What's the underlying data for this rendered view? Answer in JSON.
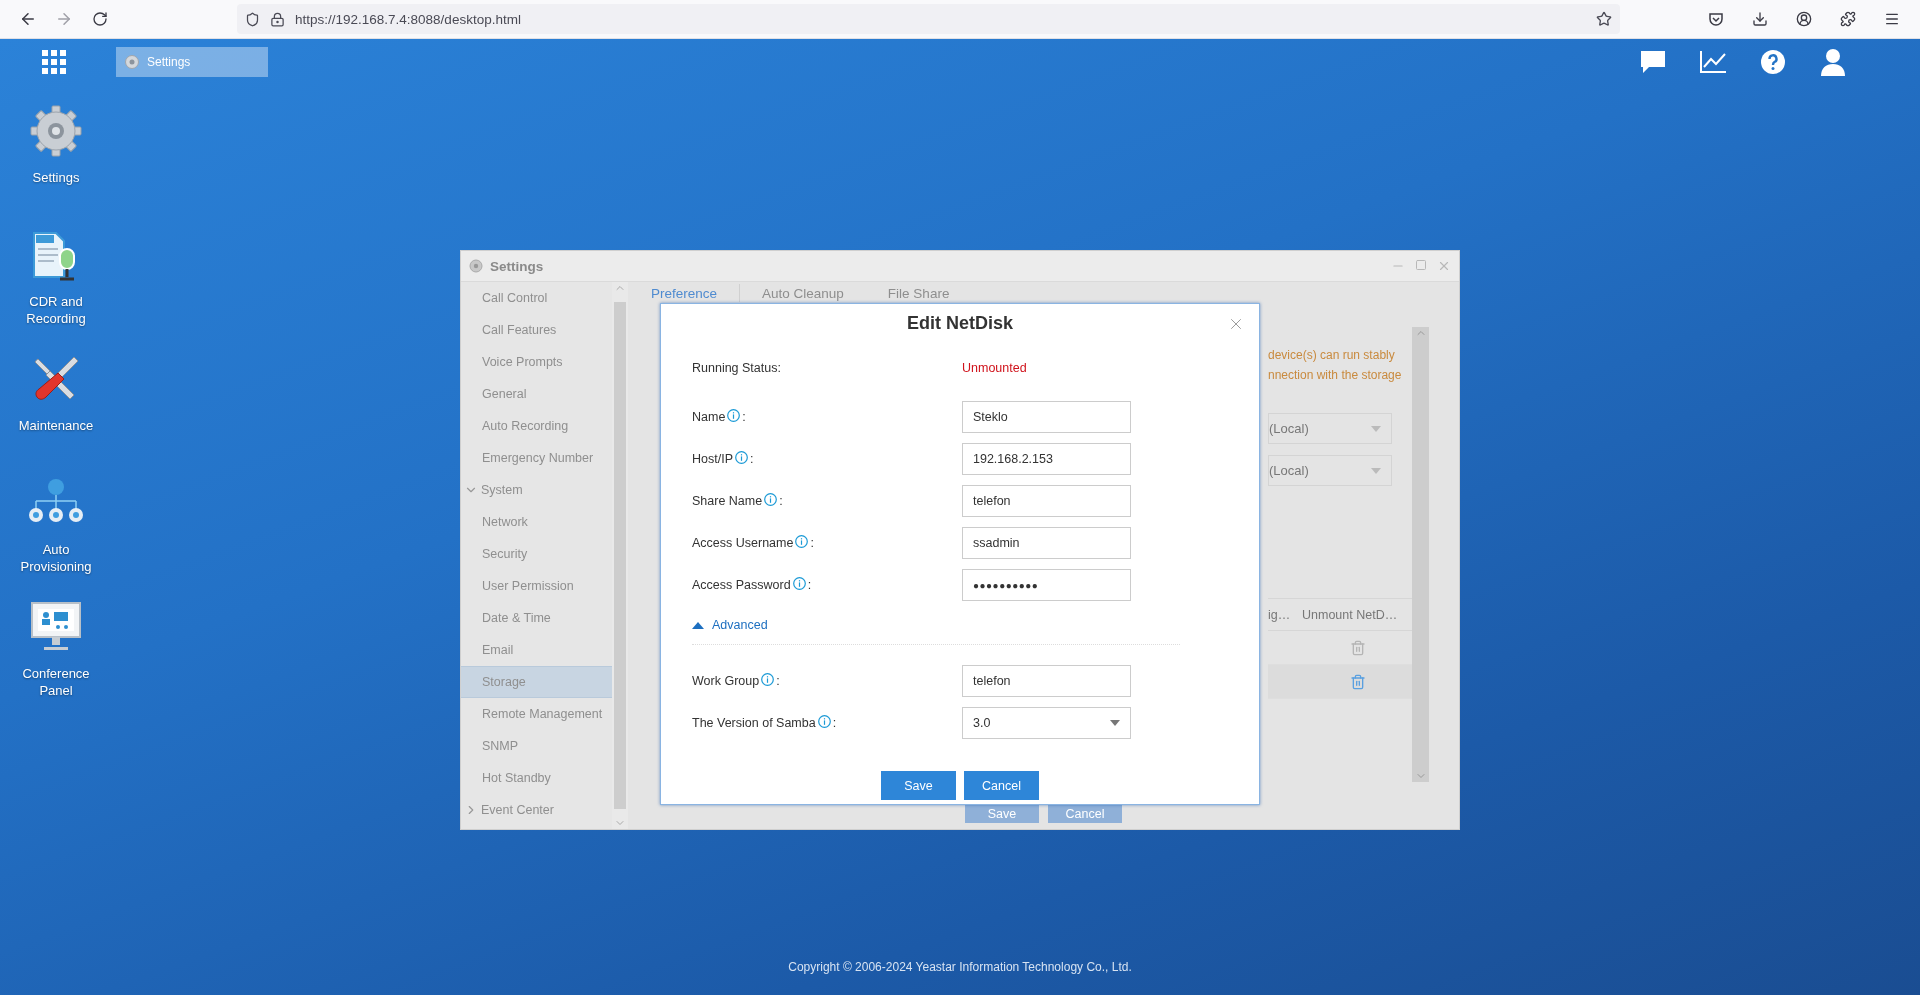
{
  "browser": {
    "url": "https://192.168.7.4:8088/desktop.html"
  },
  "taskbar": {
    "tasks": [
      {
        "label": "Settings",
        "selected": true
      }
    ]
  },
  "desktop_icons": [
    {
      "label": "Settings",
      "kind": "settings"
    },
    {
      "label": "CDR and Recording",
      "kind": "cdr"
    },
    {
      "label": "Maintenance",
      "kind": "maintenance"
    },
    {
      "label": "Auto Provisioning",
      "kind": "provisioning"
    },
    {
      "label": "Conference Panel",
      "kind": "conference"
    }
  ],
  "settings_window": {
    "title": "Settings",
    "nav": [
      {
        "label": "Call Control",
        "selected": false
      },
      {
        "label": "Call Features",
        "selected": false
      },
      {
        "label": "Voice Prompts",
        "selected": false
      },
      {
        "label": "General",
        "selected": false
      },
      {
        "label": "Auto Recording",
        "selected": false
      },
      {
        "label": "Emergency Number",
        "selected": false
      },
      {
        "label": "System",
        "expanded": true,
        "children": [
          {
            "label": "Network",
            "selected": false
          },
          {
            "label": "Security",
            "selected": false
          },
          {
            "label": "User Permission",
            "selected": false
          },
          {
            "label": "Date & Time",
            "selected": false
          },
          {
            "label": "Email",
            "selected": false
          },
          {
            "label": "Storage",
            "selected": true
          },
          {
            "label": "Remote Management",
            "selected": false
          },
          {
            "label": "SNMP",
            "selected": false
          },
          {
            "label": "Hot Standby",
            "selected": false
          }
        ]
      },
      {
        "label": "Event Center",
        "expanded": false
      }
    ],
    "tabs": [
      {
        "label": "Preference",
        "selected": true
      },
      {
        "label": "Auto Cleanup",
        "selected": false
      },
      {
        "label": "File Share",
        "selected": false
      }
    ],
    "notice": [
      "device(s) can run stably",
      "nnection with the storage"
    ],
    "selects": [
      "(Local)",
      "(Local)"
    ],
    "table": {
      "columns": [
        "ig…",
        "Unmount NetD…"
      ],
      "rows": [
        {
          "selected": false
        },
        {
          "selected": true
        }
      ]
    },
    "buttons": [
      "Save",
      "Cancel"
    ]
  },
  "dialog": {
    "title": "Edit NetDisk",
    "label_suffix": ":",
    "status": {
      "label": "Running Status:",
      "value": "Unmounted"
    },
    "fields": [
      {
        "label": "Name",
        "value": "Steklo",
        "kind": "text"
      },
      {
        "label": "Host/IP",
        "value": "192.168.2.153",
        "kind": "text"
      },
      {
        "label": "Share Name",
        "value": "telefon",
        "kind": "text"
      },
      {
        "label": "Access Username",
        "value": "ssadmin",
        "kind": "text"
      },
      {
        "label": "Access Password",
        "value": "●●●●●●●●●●",
        "kind": "password"
      }
    ],
    "advanced": {
      "label": "Advanced",
      "expanded": true
    },
    "advanced_fields": [
      {
        "label": "Work Group",
        "value": "telefon",
        "kind": "text"
      },
      {
        "label": "The Version of Samba",
        "value": "3.0",
        "kind": "select"
      }
    ],
    "buttons": [
      "Save",
      "Cancel"
    ]
  },
  "footer": "Copyright © 2006-2024 Yeastar Information Technology Co., Ltd."
}
